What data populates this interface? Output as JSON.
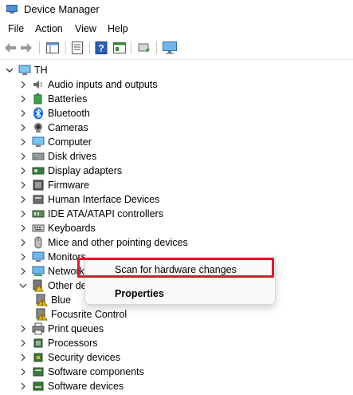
{
  "window": {
    "title": "Device Manager",
    "icon": "device-manager-icon"
  },
  "menu": [
    "File",
    "Action",
    "View",
    "Help"
  ],
  "toolbar": {
    "buttons": [
      "back-arrow-icon",
      "forward-arrow-icon",
      "show-hide-tree-icon",
      "properties-sheet-icon",
      "help-icon",
      "scan-console-icon",
      "update-driver-icon",
      "monitor-icon"
    ]
  },
  "tree": {
    "root": {
      "label": "TH",
      "icon": "computer-icon"
    },
    "items": [
      {
        "label": "Audio inputs and outputs",
        "icon": "speaker-icon"
      },
      {
        "label": "Batteries",
        "icon": "battery-icon"
      },
      {
        "label": "Bluetooth",
        "icon": "bluetooth-icon"
      },
      {
        "label": "Cameras",
        "icon": "camera-icon"
      },
      {
        "label": "Computer",
        "icon": "computer-icon"
      },
      {
        "label": "Disk drives",
        "icon": "disk-drive-icon"
      },
      {
        "label": "Display adapters",
        "icon": "display-adapter-icon"
      },
      {
        "label": "Firmware",
        "icon": "firmware-icon"
      },
      {
        "label": "Human Interface Devices",
        "icon": "hid-icon"
      },
      {
        "label": "IDE ATA/ATAPI controllers",
        "icon": "ide-controller-icon"
      },
      {
        "label": "Keyboards",
        "icon": "keyboard-icon"
      },
      {
        "label": "Mice and other pointing devices",
        "icon": "mouse-icon"
      },
      {
        "label": "Monitors",
        "icon": "monitor-icon"
      },
      {
        "label": "Network",
        "icon": "network-icon"
      },
      {
        "label": "Other de",
        "icon": "other-devices-icon"
      },
      {
        "label": "Blue",
        "icon": "warning-device-icon"
      },
      {
        "label": "Focusrite Control",
        "icon": "warning-device-icon"
      },
      {
        "label": "Print queues",
        "icon": "printer-icon"
      },
      {
        "label": "Processors",
        "icon": "processor-icon"
      },
      {
        "label": "Security devices",
        "icon": "security-device-icon"
      },
      {
        "label": "Software components",
        "icon": "software-component-icon"
      },
      {
        "label": "Software devices",
        "icon": "software-device-icon"
      }
    ]
  },
  "context_menu": {
    "items": [
      "Scan for hardware changes",
      "Properties"
    ]
  },
  "colors": {
    "highlight_border": "#e0182d",
    "accent_blue": "#1e6fd9"
  }
}
